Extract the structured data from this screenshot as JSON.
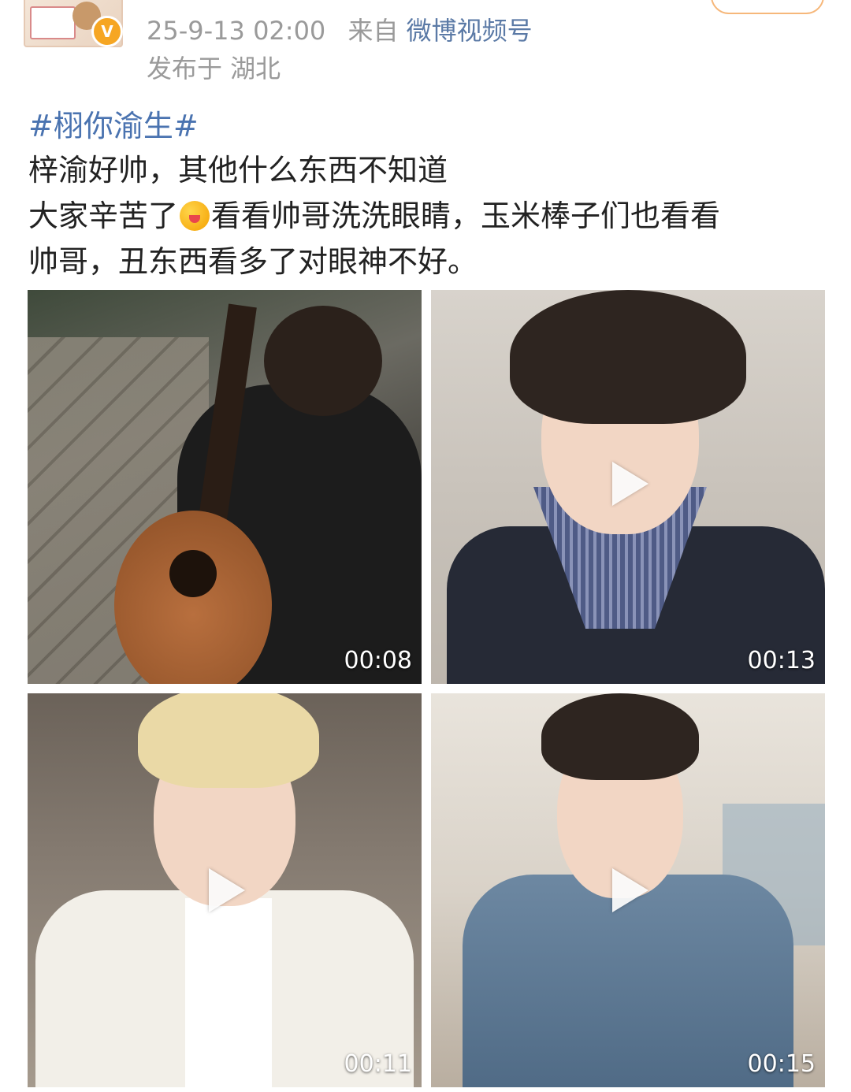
{
  "post": {
    "timestamp": "25-9-13 02:00",
    "source_prefix": "来自",
    "source": "微博视频号",
    "location": "发布于 湖北",
    "verified_badge": "V",
    "hashtag": "#栩你渝生#",
    "line1": "梓渝好帅，其他什么东西不知道",
    "line2_a": "大家辛苦了",
    "line2_b": "看看帅哥洗洗眼睛，玉米棒子们也看看",
    "line3": "帅哥，丑东西看多了对眼神不好。"
  },
  "videos": [
    {
      "duration": "00:08"
    },
    {
      "duration": "00:13"
    },
    {
      "duration": "00:11"
    },
    {
      "duration": "00:15"
    }
  ],
  "icons": [
    "avatar",
    "verified-badge-icon",
    "emoji-icon",
    "play-icon"
  ]
}
